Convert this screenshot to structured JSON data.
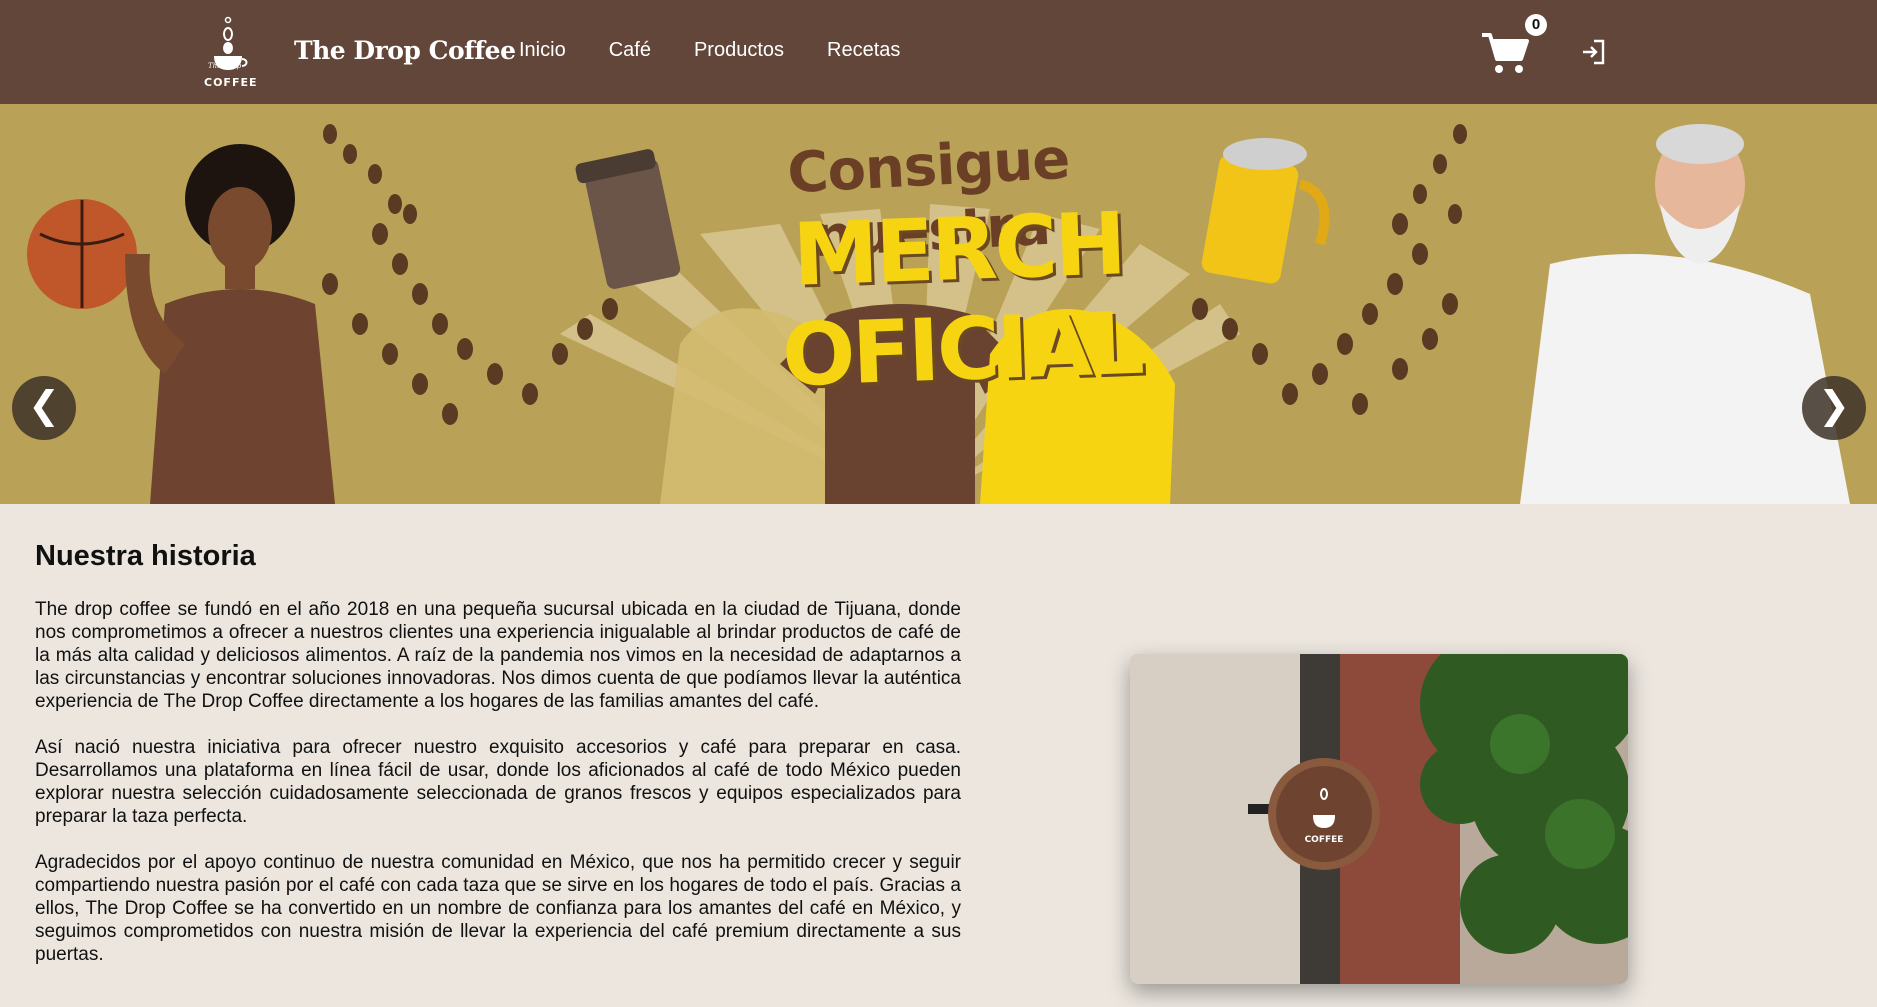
{
  "nav": {
    "brand": "The Drop Coffee",
    "logo_text_1": "The Drop",
    "logo_text_2": "COFFEE",
    "links": [
      {
        "label": "Inicio"
      },
      {
        "label": "Café"
      },
      {
        "label": "Productos"
      },
      {
        "label": "Recetas"
      }
    ],
    "cart_count": "0"
  },
  "hero": {
    "title_line1": "Consigue nuestra",
    "title_line2": "MERCH OFICIAL",
    "prev_label": "❮",
    "next_label": "❯",
    "merch_logo_text": "COFFEE"
  },
  "story": {
    "title": "Nuestra historia",
    "paragraphs": [
      "The drop coffee se fundó en el año 2018 en una pequeña sucursal ubicada en la ciudad de Tijuana, donde nos comprometimos a ofrecer a nuestros clientes una experiencia inigualable al brindar productos de café de la más alta calidad y deliciosos alimentos. A raíz de la pandemia nos vimos en la necesidad de adaptarnos a las circunstancias y encontrar soluciones innovadoras. Nos dimos cuenta de que podíamos llevar la auténtica experiencia de The Drop Coffee directamente a los hogares de las familias amantes del café.",
      "Así nació nuestra iniciativa para ofrecer nuestro exquisito accesorios y café para preparar en casa. Desarrollamos una plataforma en línea fácil de usar, donde los aficionados al café de todo México pueden explorar nuestra selección cuidadosamente seleccionada de granos frescos y equipos especializados para preparar la taza perfecta.",
      "Agradecidos por el apoyo continuo de nuestra comunidad en México, que nos ha permitido crecer y seguir compartiendo nuestra pasión por el café con cada taza que se sirve en los hogares de todo el país. Gracias a ellos, The Drop Coffee se ha convertido en un nombre de confianza para los amantes del café en México, y seguimos comprometidos con nuestra misión de llevar la experiencia del café premium directamente a sus puertas."
    ]
  },
  "colors": {
    "navbar": "#62463a",
    "hero_bg": "#b9a257",
    "page_bg": "#ece6df",
    "accent_yellow": "#f7d412",
    "coffee_brown": "#6b3f26"
  },
  "icons": {
    "cart": "cart-icon",
    "login": "login-icon",
    "prev": "chevron-left-icon",
    "next": "chevron-right-icon"
  }
}
